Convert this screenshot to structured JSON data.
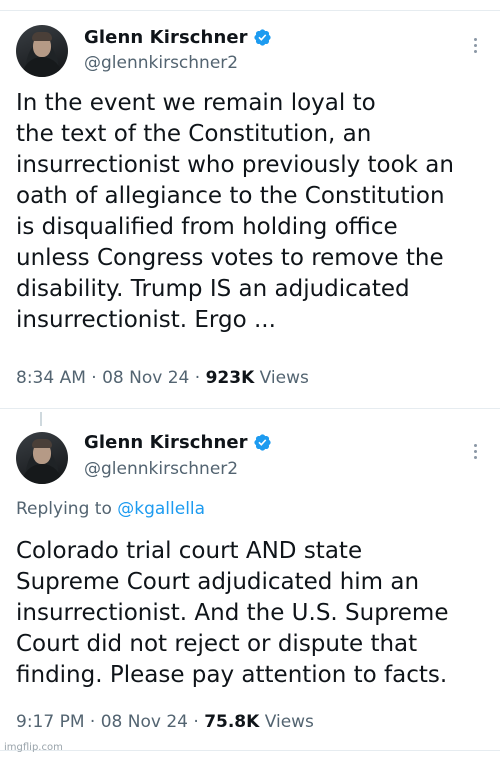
{
  "tweets": [
    {
      "author_name": "Glenn Kirschner",
      "handle": "@glennkirschner2",
      "text": "In the event we remain loyal to\nthe text of the Constitution, an\ninsurrectionist who previously took an\noath of allegiance to the Constitution\nis disqualified from holding office\nunless Congress votes to remove the\ndisability. Trump IS an adjudicated\ninsurrectionist. Ergo ...",
      "time": "8:34 AM",
      "date": "08 Nov 24",
      "views_count": "923K",
      "views_label": "Views"
    },
    {
      "author_name": "Glenn Kirschner",
      "handle": "@glennkirschner2",
      "replying_to_label": "Replying to",
      "replying_to_handle": "@kgallella",
      "text": "Colorado trial court AND state\nSupreme Court adjudicated him an\ninsurrectionist. And the U.S. Supreme\nCourt did not reject or dispute that\nfinding. Please pay attention to facts.",
      "time": "9:17 PM",
      "date": "08 Nov 24",
      "views_count": "75.8K",
      "views_label": "Views"
    }
  ],
  "separator": "·",
  "watermark": "imgflip.com",
  "icons": {
    "verified": "verified-badge-icon",
    "more": "more-options-icon"
  },
  "colors": {
    "verified_blue": "#1d9bf0",
    "secondary_text": "#536471",
    "mention": "#1d9bf0"
  }
}
